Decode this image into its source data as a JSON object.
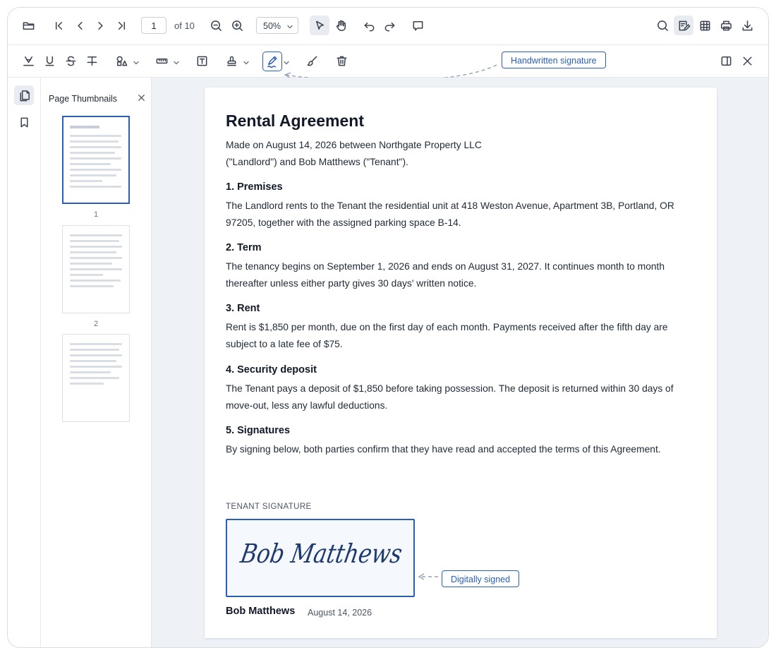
{
  "toolbar": {
    "page_current": "1",
    "page_of": "of 10",
    "zoom": "50%",
    "icons": [
      "folder-open-icon",
      "first-page-icon",
      "previous-page-icon",
      "next-page-icon",
      "last-page-icon",
      "zoom-out-icon",
      "zoom-in-icon",
      "select-tool-icon",
      "pan-tool-icon",
      "undo-icon",
      "redo-icon",
      "comment-icon",
      "search-icon",
      "annotate-icon",
      "table-icon",
      "print-icon",
      "download-icon"
    ]
  },
  "annotation_toolbar": {
    "icons": [
      "highlight-icon",
      "underline-icon",
      "strikethrough-icon",
      "text-strike-icon",
      "shapes-icon",
      "measure-icon",
      "text-box-icon",
      "stamp-icon",
      "signature-icon",
      "brush-icon",
      "delete-icon",
      "panel-toggle-icon",
      "close-icon"
    ],
    "callout_signature_tool": "Handwritten signature"
  },
  "sidebar": {
    "title": "Page Thumbnails",
    "thumbnails": [
      {
        "label": "1"
      },
      {
        "label": "2"
      },
      {
        "label": ""
      }
    ]
  },
  "document": {
    "title": "Rental Agreement",
    "intro": "Made on August 14, 2026 between Northgate Property LLC (\"Landlord\") and Bob Matthews (\"Tenant\").",
    "sections": [
      {
        "heading": "1. Premises",
        "body": "The Landlord rents to the Tenant the residential unit at 418 Weston Avenue, Apartment 3B, Portland, OR 97205, together with the assigned parking space B-14."
      },
      {
        "heading": "2. Term",
        "body": "The tenancy begins on September 1, 2026 and ends on August 31, 2027. It continues month to month thereafter unless either party gives 30 days' written notice."
      },
      {
        "heading": "3. Rent",
        "body": "Rent is $1,850 per month, due on the first day of each month. Payments received after the fifth day are subject to a late fee of $75."
      },
      {
        "heading": "4. Security deposit",
        "body": "The Tenant pays a deposit of $1,850 before taking possession. The deposit is returned within 30 days of move-out, less any lawful deductions."
      },
      {
        "heading": "5. Signatures",
        "body": "By signing below, both parties confirm that they have read and accepted the terms of this Agreement."
      }
    ],
    "signature": {
      "label": "TENANT SIGNATURE",
      "handwritten": "Bob Matthews",
      "name": "Bob Matthews",
      "date": "August 14, 2026",
      "callout": "Digitally signed"
    }
  },
  "colors": {
    "accent": "#2b5fb5",
    "viewer_bg": "#eef1f6"
  }
}
